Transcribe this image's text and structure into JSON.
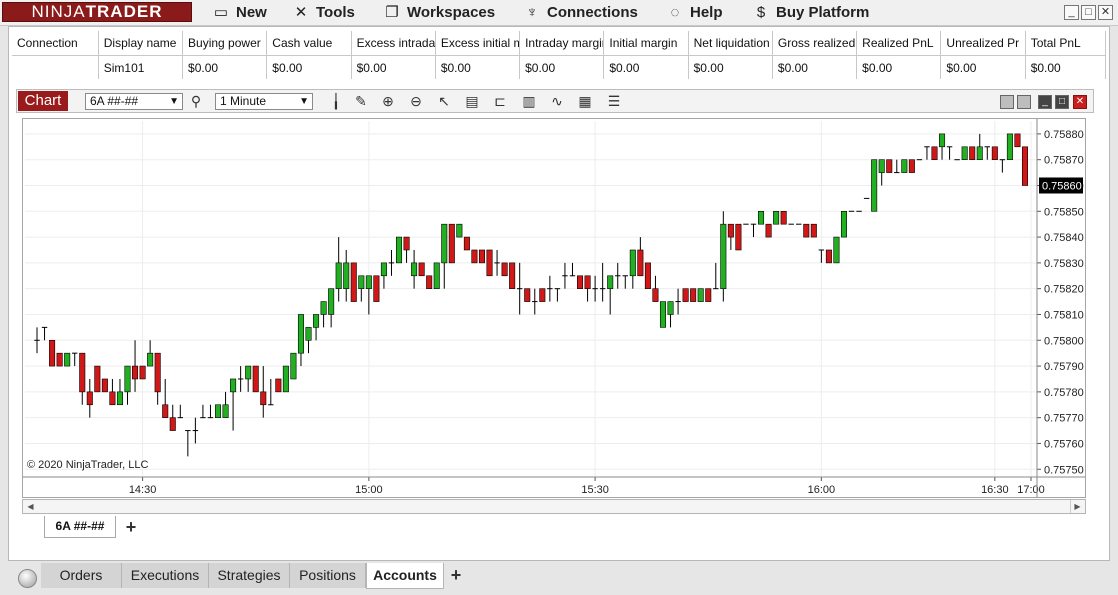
{
  "menubar": {
    "logo_left": "NINJA",
    "logo_right": "TRADER",
    "items": [
      {
        "label": "New",
        "icon": "new-window-icon"
      },
      {
        "label": "Tools",
        "icon": "tools-icon"
      },
      {
        "label": "Workspaces",
        "icon": "workspaces-icon"
      },
      {
        "label": "Connections",
        "icon": "plug-icon"
      },
      {
        "label": "Help",
        "icon": "lifebuoy-icon"
      },
      {
        "label": "Buy Platform",
        "icon": "dollar-icon"
      }
    ]
  },
  "accounts": {
    "columns": [
      "Connection",
      "Display name",
      "Buying power",
      "Cash value",
      "Excess intraday",
      "Excess initial margin",
      "Intraday margin",
      "Initial margin",
      "Net liquidation",
      "Gross realized",
      "Realized PnL",
      "Unrealized Pr",
      "Total PnL"
    ],
    "rows": [
      [
        "",
        "Sim101",
        "$0.00",
        "$0.00",
        "$0.00",
        "$0.00",
        "$0.00",
        "$0.00",
        "$0.00",
        "$0.00",
        "$0.00",
        "$0.00",
        "$0.00"
      ]
    ]
  },
  "chart": {
    "tab_label": "Chart",
    "instrument": "6A ##-##",
    "interval": "1 Minute",
    "copyright": "© 2020 NinjaTrader, LLC",
    "instrument_tab": "6A ##-##",
    "colors": {
      "up": "#22b022",
      "down": "#d01818",
      "price_marker_bg": "#000000"
    }
  },
  "chart_data": {
    "type": "candlestick",
    "x_tick_labels": [
      "14:30",
      "15:00",
      "15:30",
      "16:00",
      "16:30",
      "17:00"
    ],
    "y_tick_labels": [
      "0.75880",
      "0.75870",
      "0.75860",
      "0.75850",
      "0.75840",
      "0.75830",
      "0.75820",
      "0.75810",
      "0.75800",
      "0.75790",
      "0.75780",
      "0.75770",
      "0.75760",
      "0.75750"
    ],
    "ylim": [
      0.75747,
      0.75885
    ],
    "last_price": "0.75860",
    "grid": true,
    "candles": [
      [
        0.758,
        0.75805,
        0.75795,
        0.758
      ],
      [
        0.75805,
        0.75805,
        0.758,
        0.75805
      ],
      [
        0.758,
        0.758,
        0.7579,
        0.7579
      ],
      [
        0.75795,
        0.75795,
        0.7579,
        0.7579
      ],
      [
        0.7579,
        0.75795,
        0.7579,
        0.75795
      ],
      [
        0.75795,
        0.75795,
        0.7579,
        0.75795
      ],
      [
        0.75795,
        0.75795,
        0.75775,
        0.7578
      ],
      [
        0.7578,
        0.75785,
        0.7577,
        0.75775
      ],
      [
        0.7579,
        0.7579,
        0.7578,
        0.7578
      ],
      [
        0.75785,
        0.75785,
        0.7578,
        0.7578
      ],
      [
        0.7578,
        0.75785,
        0.75775,
        0.75775
      ],
      [
        0.75775,
        0.75785,
        0.75775,
        0.7578
      ],
      [
        0.7578,
        0.7579,
        0.75775,
        0.7579
      ],
      [
        0.7579,
        0.758,
        0.7578,
        0.75785
      ],
      [
        0.7579,
        0.7579,
        0.75785,
        0.75785
      ],
      [
        0.7579,
        0.758,
        0.7579,
        0.75795
      ],
      [
        0.75795,
        0.75795,
        0.75775,
        0.7578
      ],
      [
        0.75775,
        0.75785,
        0.7577,
        0.7577
      ],
      [
        0.7577,
        0.75775,
        0.75765,
        0.75765
      ],
      [
        0.7577,
        0.75775,
        0.7577,
        0.7577
      ],
      [
        0.75765,
        0.75765,
        0.75755,
        0.75765
      ],
      [
        0.75765,
        0.7577,
        0.7576,
        0.75765
      ],
      [
        0.7577,
        0.75775,
        0.7577,
        0.7577
      ],
      [
        0.7577,
        0.75775,
        0.7577,
        0.7577
      ],
      [
        0.7577,
        0.75775,
        0.7577,
        0.75775
      ],
      [
        0.7577,
        0.7578,
        0.7577,
        0.75775
      ],
      [
        0.7578,
        0.75785,
        0.75765,
        0.75785
      ],
      [
        0.75785,
        0.7579,
        0.7578,
        0.75785
      ],
      [
        0.75785,
        0.7579,
        0.7578,
        0.7579
      ],
      [
        0.7579,
        0.7579,
        0.7578,
        0.7578
      ],
      [
        0.7578,
        0.7579,
        0.7577,
        0.75775
      ],
      [
        0.75775,
        0.75785,
        0.75775,
        0.75775
      ],
      [
        0.75785,
        0.75785,
        0.7578,
        0.7578
      ],
      [
        0.7578,
        0.7579,
        0.7578,
        0.7579
      ],
      [
        0.75785,
        0.75795,
        0.75785,
        0.75795
      ],
      [
        0.75795,
        0.7581,
        0.7579,
        0.7581
      ],
      [
        0.758,
        0.75805,
        0.75795,
        0.75805
      ],
      [
        0.75805,
        0.7581,
        0.758,
        0.7581
      ],
      [
        0.7581,
        0.75815,
        0.75805,
        0.75815
      ],
      [
        0.7581,
        0.7582,
        0.75805,
        0.7582
      ],
      [
        0.7582,
        0.7584,
        0.75815,
        0.7583
      ],
      [
        0.7582,
        0.75835,
        0.75815,
        0.7583
      ],
      [
        0.7583,
        0.7583,
        0.75815,
        0.75815
      ],
      [
        0.7582,
        0.75825,
        0.75815,
        0.75825
      ],
      [
        0.7582,
        0.75825,
        0.7581,
        0.75825
      ],
      [
        0.75825,
        0.75825,
        0.75815,
        0.75815
      ],
      [
        0.75825,
        0.7583,
        0.7582,
        0.7583
      ],
      [
        0.7583,
        0.75835,
        0.75825,
        0.7583
      ],
      [
        0.7583,
        0.7584,
        0.7583,
        0.7584
      ],
      [
        0.7584,
        0.7584,
        0.7583,
        0.75835
      ],
      [
        0.75825,
        0.75835,
        0.7582,
        0.7583
      ],
      [
        0.7583,
        0.7583,
        0.75825,
        0.75825
      ],
      [
        0.75825,
        0.75825,
        0.7582,
        0.7582
      ],
      [
        0.7582,
        0.7583,
        0.7582,
        0.7583
      ],
      [
        0.7583,
        0.75845,
        0.7582,
        0.75845
      ],
      [
        0.75845,
        0.75845,
        0.7583,
        0.7583
      ],
      [
        0.7584,
        0.75845,
        0.7584,
        0.75845
      ],
      [
        0.7584,
        0.7584,
        0.75835,
        0.75835
      ],
      [
        0.75835,
        0.75835,
        0.7583,
        0.7583
      ],
      [
        0.75835,
        0.75835,
        0.7583,
        0.7583
      ],
      [
        0.75835,
        0.75835,
        0.75825,
        0.75825
      ],
      [
        0.7583,
        0.75835,
        0.75825,
        0.7583
      ],
      [
        0.7583,
        0.7583,
        0.75825,
        0.75825
      ],
      [
        0.7583,
        0.7583,
        0.7582,
        0.7582
      ],
      [
        0.7582,
        0.7583,
        0.7581,
        0.7582
      ],
      [
        0.7582,
        0.7582,
        0.75815,
        0.75815
      ],
      [
        0.75815,
        0.7582,
        0.7581,
        0.75815
      ],
      [
        0.7582,
        0.7582,
        0.75815,
        0.75815
      ],
      [
        0.7582,
        0.75825,
        0.75815,
        0.7582
      ],
      [
        0.7582,
        0.7582,
        0.75815,
        0.7582
      ],
      [
        0.75825,
        0.7583,
        0.7582,
        0.75825
      ],
      [
        0.75825,
        0.7583,
        0.75825,
        0.75825
      ],
      [
        0.75825,
        0.75825,
        0.7582,
        0.7582
      ],
      [
        0.75825,
        0.75825,
        0.75815,
        0.7582
      ],
      [
        0.7582,
        0.75825,
        0.75815,
        0.7582
      ],
      [
        0.7582,
        0.7583,
        0.75815,
        0.7582
      ],
      [
        0.7582,
        0.75825,
        0.7581,
        0.75825
      ],
      [
        0.75825,
        0.7583,
        0.7582,
        0.75825
      ],
      [
        0.75825,
        0.75825,
        0.7582,
        0.75825
      ],
      [
        0.75825,
        0.75835,
        0.7582,
        0.75835
      ],
      [
        0.75835,
        0.7584,
        0.75825,
        0.75825
      ],
      [
        0.7583,
        0.7583,
        0.7582,
        0.7582
      ],
      [
        0.7582,
        0.75825,
        0.75815,
        0.75815
      ],
      [
        0.75805,
        0.75815,
        0.75805,
        0.75815
      ],
      [
        0.7581,
        0.75815,
        0.75805,
        0.75815
      ],
      [
        0.75815,
        0.7582,
        0.7581,
        0.75815
      ],
      [
        0.7582,
        0.7582,
        0.75815,
        0.75815
      ],
      [
        0.7582,
        0.7582,
        0.75815,
        0.75815
      ],
      [
        0.75815,
        0.7582,
        0.75815,
        0.7582
      ],
      [
        0.7582,
        0.7582,
        0.75815,
        0.75815
      ],
      [
        0.7582,
        0.7583,
        0.7582,
        0.7582
      ],
      [
        0.7582,
        0.7585,
        0.75815,
        0.75845
      ],
      [
        0.75845,
        0.75845,
        0.75835,
        0.7584
      ],
      [
        0.75845,
        0.75845,
        0.75835,
        0.75835
      ],
      [
        0.75845,
        0.75845,
        0.75845,
        0.75845
      ],
      [
        0.75845,
        0.75845,
        0.7584,
        0.75845
      ],
      [
        0.75845,
        0.7585,
        0.75845,
        0.7585
      ],
      [
        0.75845,
        0.75845,
        0.7584,
        0.7584
      ],
      [
        0.75845,
        0.7585,
        0.75845,
        0.7585
      ],
      [
        0.7585,
        0.7585,
        0.75845,
        0.75845
      ],
      [
        0.75845,
        0.75845,
        0.75845,
        0.75845
      ],
      [
        0.75845,
        0.75845,
        0.75845,
        0.75845
      ],
      [
        0.75845,
        0.75845,
        0.7584,
        0.7584
      ],
      [
        0.75845,
        0.75845,
        0.7584,
        0.7584
      ],
      [
        0.75835,
        0.75835,
        0.7583,
        0.75835
      ],
      [
        0.75835,
        0.75835,
        0.7583,
        0.7583
      ],
      [
        0.7583,
        0.7584,
        0.7583,
        0.7584
      ],
      [
        0.7584,
        0.7585,
        0.7584,
        0.7585
      ],
      [
        0.7585,
        0.7585,
        0.7585,
        0.7585
      ],
      [
        0.7585,
        0.7585,
        0.7585,
        0.7585
      ],
      [
        0.75855,
        0.75855,
        0.75855,
        0.75855
      ],
      [
        0.7585,
        0.7587,
        0.7585,
        0.7587
      ],
      [
        0.75865,
        0.7587,
        0.7586,
        0.7587
      ],
      [
        0.7587,
        0.7587,
        0.75865,
        0.75865
      ],
      [
        0.75865,
        0.7587,
        0.75865,
        0.75865
      ],
      [
        0.75865,
        0.7587,
        0.75865,
        0.7587
      ],
      [
        0.7587,
        0.7587,
        0.75865,
        0.75865
      ],
      [
        0.7587,
        0.7587,
        0.7587,
        0.7587
      ],
      [
        0.75875,
        0.75875,
        0.7587,
        0.75875
      ],
      [
        0.75875,
        0.75875,
        0.7587,
        0.7587
      ],
      [
        0.75875,
        0.7588,
        0.7587,
        0.7588
      ],
      [
        0.75875,
        0.75875,
        0.7587,
        0.75875
      ],
      [
        0.7587,
        0.7587,
        0.7587,
        0.7587
      ],
      [
        0.7587,
        0.75875,
        0.7587,
        0.75875
      ],
      [
        0.75875,
        0.75875,
        0.7587,
        0.7587
      ],
      [
        0.7587,
        0.7588,
        0.7587,
        0.75875
      ],
      [
        0.75875,
        0.75875,
        0.7587,
        0.75875
      ],
      [
        0.75875,
        0.75875,
        0.7587,
        0.7587
      ],
      [
        0.7587,
        0.7587,
        0.75865,
        0.7587
      ],
      [
        0.7587,
        0.7588,
        0.7587,
        0.7588
      ],
      [
        0.7588,
        0.7588,
        0.75875,
        0.75875
      ],
      [
        0.75875,
        0.75875,
        0.7586,
        0.7586
      ]
    ]
  },
  "bottom_tabs": [
    {
      "label": "Orders",
      "active": false
    },
    {
      "label": "Executions",
      "active": false
    },
    {
      "label": "Strategies",
      "active": false
    },
    {
      "label": "Positions",
      "active": false
    },
    {
      "label": "Accounts",
      "active": true
    }
  ]
}
